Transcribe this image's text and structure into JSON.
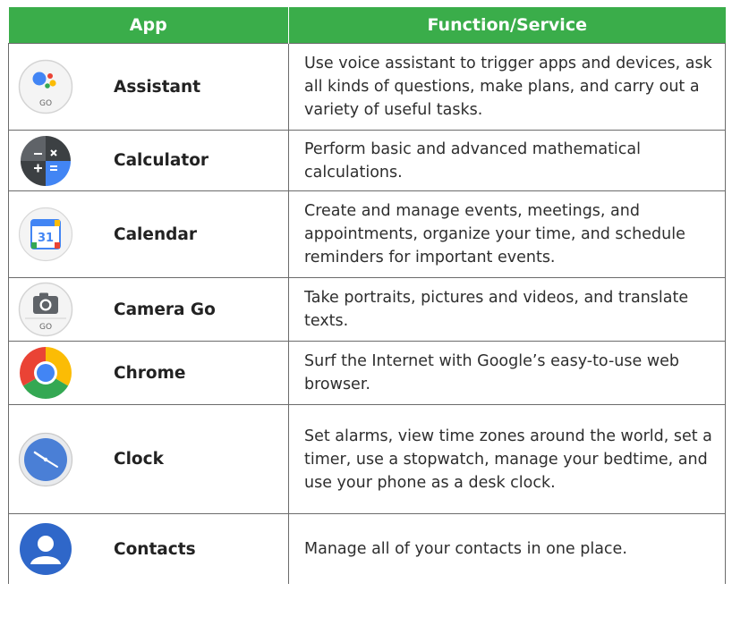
{
  "header": {
    "app": "App",
    "function": "Function/Service"
  },
  "colors": {
    "header_bg": "#3aad4a",
    "border": "#6b6b6b",
    "text": "#2e2e2e"
  },
  "rows": [
    {
      "icon": "assistant-go-icon",
      "name": "Assistant",
      "icon_label": "GO",
      "description": "Use voice assistant to trigger apps and devices, ask all kinds of questions, make plans, and carry out a variety of useful tasks."
    },
    {
      "icon": "calculator-icon",
      "name": "Calculator",
      "description": "Perform basic and advanced mathematical calculations."
    },
    {
      "icon": "calendar-icon",
      "name": "Calendar",
      "icon_label": "31",
      "description": "Create and manage events, meetings, and appointments, organize your time, and schedule reminders for important events."
    },
    {
      "icon": "camera-go-icon",
      "name": "Camera Go",
      "icon_label": "GO",
      "description": "Take portraits, pictures and videos, and translate texts."
    },
    {
      "icon": "chrome-icon",
      "name": "Chrome",
      "description": "Surf the Internet with Google’s easy-to-use web browser."
    },
    {
      "icon": "clock-icon",
      "name": "Clock",
      "description": "Set alarms, view time zones around the world, set a timer, use a stopwatch, manage your bedtime, and use your phone as a desk clock."
    },
    {
      "icon": "contacts-icon",
      "name": "Contacts",
      "description": "Manage all of your contacts in one place."
    }
  ]
}
